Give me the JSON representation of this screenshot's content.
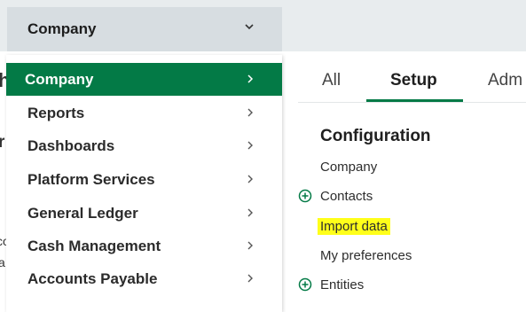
{
  "topbar": {
    "company_select": {
      "label": "Company"
    }
  },
  "menu": {
    "items": [
      {
        "label": "Company",
        "active": true
      },
      {
        "label": "Reports"
      },
      {
        "label": "Dashboards"
      },
      {
        "label": "Platform Services"
      },
      {
        "label": "General Ledger"
      },
      {
        "label": "Cash Management"
      },
      {
        "label": "Accounts Payable"
      }
    ]
  },
  "background_fragments": [
    "h",
    "r",
    "co",
    "a"
  ],
  "tabs": [
    {
      "label": "All"
    },
    {
      "label": "Setup",
      "active": true
    },
    {
      "label": "Adm"
    }
  ],
  "panel": {
    "title": "Configuration",
    "links": [
      {
        "label": "Company",
        "icon": null
      },
      {
        "label": "Contacts",
        "icon": "plus-circle-icon"
      },
      {
        "label": "Import data",
        "highlighted": true
      },
      {
        "label": "My preferences"
      },
      {
        "label": "Entities",
        "icon": "plus-circle-icon"
      }
    ]
  },
  "colors": {
    "accent_green": "#037a46",
    "highlight_yellow": "#ffff1a",
    "topbar_bg": "#e8ecee",
    "select_bg": "#d7dde1"
  }
}
